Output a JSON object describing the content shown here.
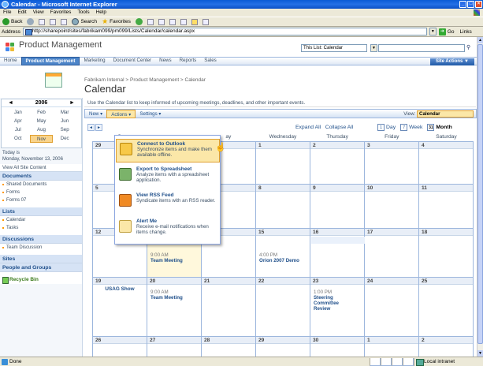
{
  "window": {
    "title": "Calendar - Microsoft Internet Explorer",
    "buttons": [
      "_",
      "□",
      "×"
    ]
  },
  "menubar": [
    "File",
    "Edit",
    "View",
    "Favorites",
    "Tools",
    "Help"
  ],
  "toolbar": {
    "back": "Back",
    "search": "Search",
    "favorites": "Favorites"
  },
  "address": {
    "label": "Address",
    "url": "http://sharepoint/sites/fabrikam099/pm099/Lists/Calendar/calendar.aspx",
    "go": "Go",
    "links": "Links"
  },
  "site": {
    "title": "Product Management",
    "scope": "This List: Calendar",
    "site_actions": "Site Actions"
  },
  "topnav": [
    "Home",
    "Product Management",
    "Marketing",
    "Document Center",
    "News",
    "Reports",
    "Sales"
  ],
  "breadcrumb": "Fabrikam Internal > Product Management > Calendar",
  "page_title": "Calendar",
  "minical": {
    "year": "2006",
    "prev": "◄",
    "next": "►",
    "months": [
      "Jan",
      "Feb",
      "Mar",
      "Apr",
      "May",
      "Jun",
      "Jul",
      "Aug",
      "Sep",
      "Oct",
      "Nov",
      "Dec"
    ],
    "today_label": "Today is",
    "today_date": "Monday, November 13, 2006"
  },
  "quicklaunch": {
    "view_all": "View All Site Content",
    "documents": "Documents",
    "doc_items": [
      "Shared Documents",
      "Forms",
      "Forms 07"
    ],
    "lists": "Lists",
    "list_items": [
      "Calendar",
      "Tasks"
    ],
    "discussions": "Discussions",
    "disc_items": [
      "Team Discussion"
    ],
    "sites": "Sites",
    "people": "People and Groups",
    "recycle": "Recycle Bin"
  },
  "description": "Use the Calendar list to keep informed of upcoming meetings, deadlines, and other important events.",
  "list_toolbar": {
    "new": "New",
    "actions": "Actions",
    "settings": "Settings",
    "view_label": "View:",
    "view_value": "Calendar"
  },
  "cal_nav": {
    "expand_all": "Expand All",
    "collapse_all": "Collapse All",
    "day": "Day",
    "week": "Week",
    "month": "Month",
    "day_icon": "1",
    "week_icon": "7",
    "month_icon": "31"
  },
  "day_headers": [
    "",
    "",
    "",
    "ay",
    "Wednesday",
    "Thursday",
    "Friday",
    "Saturday"
  ],
  "weekdays": [
    "S",
    "",
    "",
    "ay",
    "Wednesday",
    "Thursday",
    "Friday",
    "Saturday"
  ],
  "menu": {
    "items": [
      {
        "title": "Connect to Outlook",
        "desc": "Synchronize items and make them available offline."
      },
      {
        "title": "Export to Spreadsheet",
        "desc": "Analyze items with a spreadsheet application."
      },
      {
        "title": "View RSS Feed",
        "desc": "Syndicate items with an RSS reader."
      },
      {
        "title": "Alert Me",
        "desc": "Receive e-mail notifications when items change."
      }
    ]
  },
  "calendar": {
    "weeks": [
      [
        "29",
        "",
        "",
        "",
        "1",
        "2",
        "3",
        "4"
      ],
      [
        "5",
        "",
        "",
        "",
        "8",
        "9",
        "10",
        "11"
      ],
      [
        "12",
        "13",
        "14",
        "15",
        "16",
        "17",
        "18"
      ],
      [
        "19",
        "20",
        "21",
        "22",
        "23",
        "24",
        "25"
      ],
      [
        "26",
        "27",
        "28",
        "29",
        "30",
        "1",
        "2"
      ]
    ],
    "events": {
      "w3_mon": {
        "time": "9:00 AM",
        "name": "Team Meeting"
      },
      "w3_wed": {
        "time": "4:00 PM",
        "name": "Orion 2007 Demo"
      },
      "w3_allday": "USAG Show",
      "w4_sun": "USAG Show",
      "w4_mon": {
        "time": "9:00 AM",
        "name": "Team Meeting"
      },
      "w4_thu": {
        "time": "1:00 PM",
        "name": "Steering Committee Review"
      }
    }
  },
  "status": {
    "done": "Done",
    "zone": "Local intranet"
  }
}
